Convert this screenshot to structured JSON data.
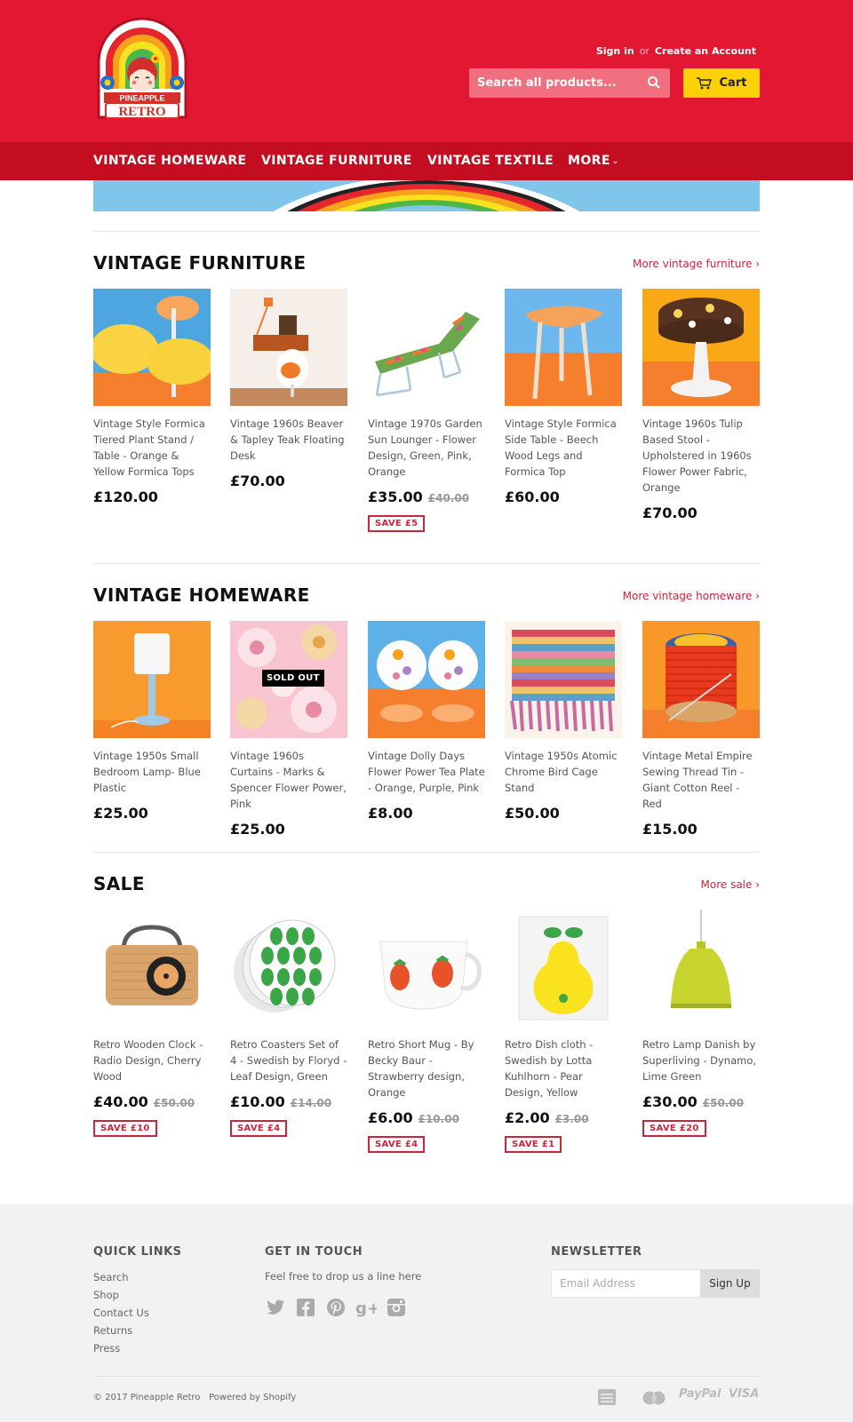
{
  "header": {
    "logo_top": "PINEAPPLE",
    "logo_bottom": "RETRO",
    "sign_in": "Sign in",
    "or": "or",
    "create_account": "Create an Account",
    "search_placeholder": "Search all products...",
    "cart_label": "Cart",
    "brand_color": "#e21833",
    "nav_color": "#c50d21",
    "cart_color": "#fcd106"
  },
  "nav": {
    "items": [
      "VINTAGE HOMEWARE",
      "VINTAGE FURNITURE",
      "VINTAGE TEXTILE",
      "MORE"
    ],
    "more_icon": "chevron-down-icon"
  },
  "sections": [
    {
      "title": "VINTAGE FURNITURE",
      "more": "More vintage furniture ›",
      "products": [
        {
          "title": "Vintage Style Formica Tiered Plant Stand / Table - Orange & Yellow Formica Tops",
          "price": "£120.00"
        },
        {
          "title": "Vintage 1960s Beaver & Tapley Teak Floating Desk",
          "price": "£70.00"
        },
        {
          "title": "Vintage 1970s Garden Sun Lounger - Flower Design, Green, Pink, Orange",
          "price": "£35.00",
          "compare": "£40.00",
          "save": "SAVE £5"
        },
        {
          "title": "Vintage Style Formica Side Table - Beech Wood Legs and Formica Top",
          "price": "£60.00"
        },
        {
          "title": "Vintage 1960s Tulip Based Stool - Upholstered in 1960s Flower Power Fabric, Orange",
          "price": "£70.00"
        }
      ]
    },
    {
      "title": "VINTAGE HOMEWARE",
      "more": "More vintage homeware ›",
      "products": [
        {
          "title": "Vintage 1950s Small Bedroom Lamp- Blue Plastic",
          "price": "£25.00"
        },
        {
          "title": "Vintage 1960s Curtains - Marks & Spencer Flower Power, Pink",
          "price": "£25.00",
          "badge": "SOLD OUT"
        },
        {
          "title": "Vintage Dolly Days Flower Power Tea Plate - Orange, Purple, Pink",
          "price": "£8.00"
        },
        {
          "title": "Vintage 1950s Atomic Chrome Bird Cage Stand",
          "price": "£50.00"
        },
        {
          "title": "Vintage Metal Empire Sewing Thread Tin - Giant Cotton Reel - Red",
          "price": "£15.00"
        }
      ]
    },
    {
      "title": "SALE",
      "more": "More sale ›",
      "products": [
        {
          "title": "Retro Wooden Clock - Radio Design, Cherry Wood",
          "price": "£40.00",
          "compare": "£50.00",
          "save": "SAVE £10"
        },
        {
          "title": "Retro Coasters Set of 4 - Swedish by Floryd - Leaf Design, Green",
          "price": "£10.00",
          "compare": "£14.00",
          "save": "SAVE £4"
        },
        {
          "title": "Retro Short Mug - By Becky Baur - Strawberry design, Orange",
          "price": "£6.00",
          "compare": "£10.00",
          "save": "SAVE £4"
        },
        {
          "title": "Retro Dish cloth - Swedish by Lotta Kuhlhorn - Pear Design, Yellow",
          "price": "£2.00",
          "compare": "£3.00",
          "save": "SAVE £1"
        },
        {
          "title": "Retro Lamp Danish by Superliving - Dynamo, Lime Green",
          "price": "£30.00",
          "compare": "£50.00",
          "save": "SAVE £20"
        }
      ]
    }
  ],
  "footer": {
    "quick_links_heading": "QUICK LINKS",
    "quick_links": [
      "Search",
      "Shop",
      "Contact Us",
      "Returns",
      "Press"
    ],
    "touch_heading": "GET IN TOUCH",
    "touch_text": "Feel free to drop us a line here",
    "social_icons": [
      "twitter-icon",
      "facebook-icon",
      "pinterest-icon",
      "google-plus-icon",
      "instagram-icon"
    ],
    "newsletter_heading": "NEWSLETTER",
    "email_placeholder": "Email Address",
    "signup_label": "Sign Up",
    "copyright": "© 2017 Pineapple Retro",
    "powered": "Powered by Shopify",
    "payment_icons": [
      "american-express-icon",
      "mastercard-icon",
      "paypal-icon",
      "visa-icon"
    ],
    "paypal_text": "PayPal",
    "visa_text": "VISA"
  }
}
